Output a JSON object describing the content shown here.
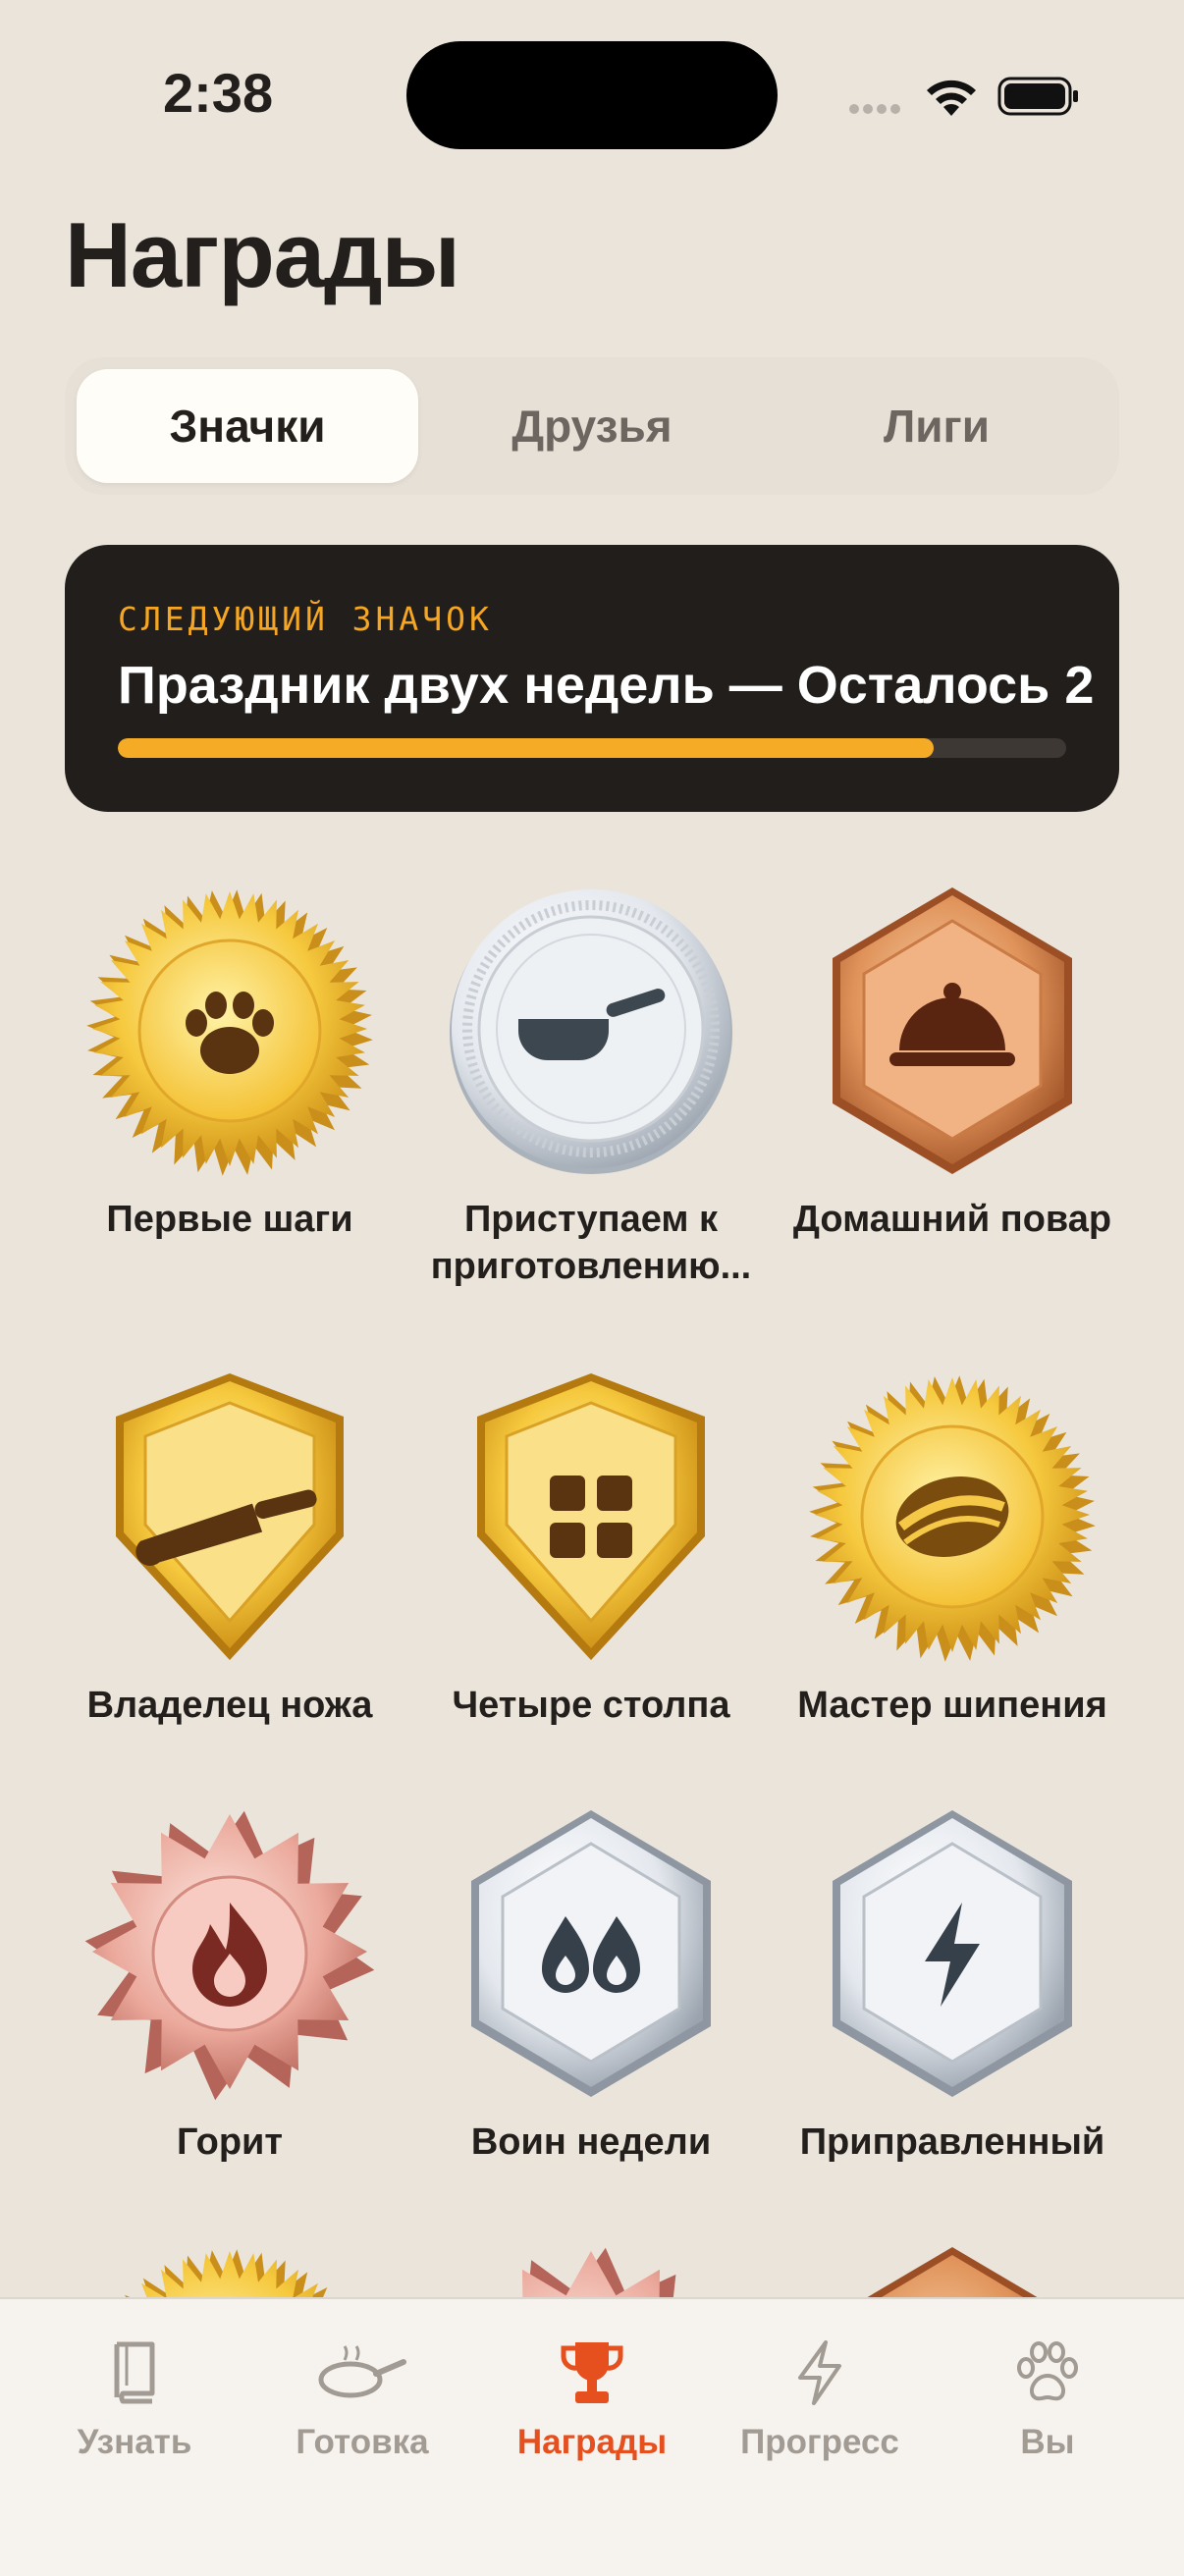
{
  "status_bar": {
    "time": "2:38"
  },
  "header": {
    "title": "Награды"
  },
  "segments": [
    {
      "label": "Значки",
      "active": true
    },
    {
      "label": "Друзья",
      "active": false
    },
    {
      "label": "Лиги",
      "active": false
    }
  ],
  "next_badge": {
    "kicker": "СЛЕДУЮЩИЙ ЗНАЧОК",
    "title": "Праздник двух недель — Осталось 2",
    "progress_percent": 86
  },
  "badges": [
    {
      "label": "Первые шаги",
      "icon": "paw-icon",
      "tier": "gold",
      "shape": "burst"
    },
    {
      "label": "Приступаем к приготовлению...",
      "label_line1": "Приступаем к",
      "label_line2": "приготовлению...",
      "icon": "saucepan-icon",
      "tier": "silver",
      "shape": "coin"
    },
    {
      "label": "Домашний повар",
      "icon": "cloche-icon",
      "tier": "bronze",
      "shape": "hexagon"
    },
    {
      "label": "Владелец ножа",
      "icon": "knife-icon",
      "tier": "gold",
      "shape": "shield"
    },
    {
      "label": "Четыре столпа",
      "icon": "grid-icon",
      "tier": "gold",
      "shape": "shield"
    },
    {
      "label": "Мастер шипения",
      "icon": "sizzle-icon",
      "tier": "gold",
      "shape": "burst"
    },
    {
      "label": "Горит",
      "icon": "flame-icon",
      "tier": "rose",
      "shape": "star"
    },
    {
      "label": "Воин недели",
      "icon": "double-flame-icon",
      "tier": "silver",
      "shape": "hexagon"
    },
    {
      "label": "Приправленный",
      "icon": "lightning-icon",
      "tier": "silver",
      "shape": "hexagon"
    }
  ],
  "tabs": [
    {
      "label": "Узнать",
      "icon": "book-icon",
      "active": false
    },
    {
      "label": "Готовка",
      "icon": "pan-icon",
      "active": false
    },
    {
      "label": "Награды",
      "icon": "trophy-icon",
      "active": true
    },
    {
      "label": "Прогресс",
      "icon": "bolt-icon",
      "active": false
    },
    {
      "label": "Вы",
      "icon": "paw-icon",
      "active": false
    }
  ],
  "colors": {
    "background": "#ebe4da",
    "accent": "#e5501e",
    "progress": "#f5ab25",
    "card": "#221e1b"
  }
}
